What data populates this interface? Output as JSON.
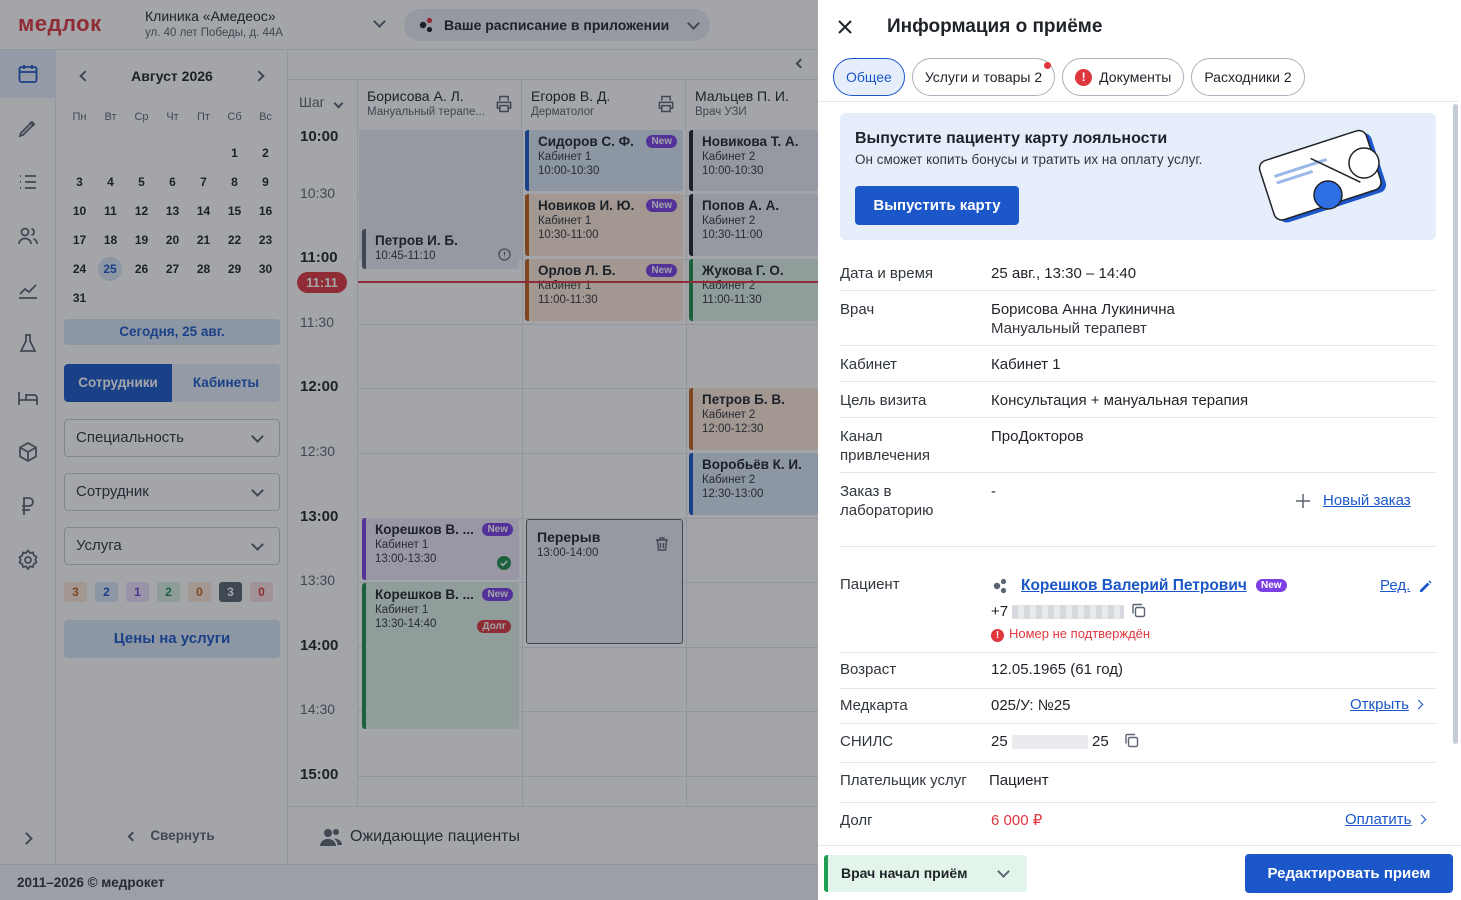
{
  "header": {
    "logo": "медлок",
    "clinic_name": "Клиника «Амедеос»",
    "clinic_address": "ул. 40 лет Победы, д. 44А",
    "app_promo": "Ваше расписание в приложении"
  },
  "calendar": {
    "month": "Август 2026",
    "weekdays": [
      "Пн",
      "Вт",
      "Ср",
      "Чт",
      "Пт",
      "Сб",
      "Вс"
    ],
    "weeks": [
      [
        "",
        "",
        "",
        "",
        "",
        "1",
        "2"
      ],
      [
        "3",
        "4",
        "5",
        "6",
        "7",
        "8",
        "9"
      ],
      [
        "10",
        "11",
        "12",
        "13",
        "14",
        "15",
        "16"
      ],
      [
        "17",
        "18",
        "19",
        "20",
        "21",
        "22",
        "23"
      ],
      [
        "24",
        "25",
        "26",
        "27",
        "28",
        "29",
        "30"
      ],
      [
        "31",
        "",
        "",
        "",
        "",
        "",
        ""
      ]
    ],
    "today_day": "25",
    "today_button": "Сегодня, 25 авг."
  },
  "filters": {
    "tab_staff": "Сотрудники",
    "tab_rooms": "Кабинеты",
    "specialty": "Специальность",
    "employee": "Сотрудник",
    "service": "Услуга",
    "counters": [
      {
        "value": "3",
        "bg": "#fde8d7",
        "fg": "#c0621c"
      },
      {
        "value": "2",
        "bg": "#dbe6f6",
        "fg": "#1b57c9"
      },
      {
        "value": "1",
        "bg": "#ede2fb",
        "fg": "#7b3fe4"
      },
      {
        "value": "2",
        "bg": "#dcf1e3",
        "fg": "#1e8e4a"
      },
      {
        "value": "0",
        "bg": "#fde8d7",
        "fg": "#c0621c"
      },
      {
        "value": "3",
        "bg": "#5b6470",
        "fg": "#ffffff"
      },
      {
        "value": "0",
        "bg": "#fde2e2",
        "fg": "#e0363e"
      }
    ],
    "prices_button": "Цены на услуги",
    "collapse": "Свернуть"
  },
  "schedule": {
    "step_label": "Шаг",
    "doctors": [
      {
        "name": "Борисова А. Л.",
        "role": "Мануальный терапе..."
      },
      {
        "name": "Егоров В. Д.",
        "role": "Дерматолог"
      },
      {
        "name": "Мальцев П. И.",
        "role": "Врач УЗИ"
      }
    ],
    "times": [
      "10:00",
      "10:30",
      "11:00",
      "11:30",
      "12:00",
      "12:30",
      "13:00",
      "13:30",
      "14:00",
      "14:30",
      "15:00"
    ],
    "now": "11:11",
    "new_label": "New",
    "debt_label": "Долг",
    "appointments": {
      "a1": {
        "patient": "Петров И. Б.",
        "time": "10:45-11:10"
      },
      "a2": {
        "patient": "Корешков В. ...",
        "room": "Кабинет 1",
        "time": "13:00-13:30"
      },
      "a3": {
        "patient": "Корешков В. ...",
        "room": "Кабинет 1",
        "time": "13:30-14:40"
      },
      "b1": {
        "patient": "Сидоров С. Ф.",
        "room": "Кабинет 1",
        "time": "10:00-10:30"
      },
      "b2": {
        "patient": "Новиков И. Ю.",
        "room": "Кабинет 1",
        "time": "10:30-11:00"
      },
      "b3": {
        "patient": "Орлов Л. Б.",
        "room": "Кабинет 1",
        "time": "11:00-11:30"
      },
      "b4": {
        "patient": "Перерыв",
        "time": "13:00-14:00"
      },
      "c1": {
        "patient": "Новикова Т. А.",
        "room": "Кабинет 2",
        "time": "10:00-10:30"
      },
      "c2": {
        "patient": "Попов А. А.",
        "room": "Кабинет 2",
        "time": "10:30-11:00"
      },
      "c3": {
        "patient": "Жукова Г. О.",
        "room": "Кабинет 2",
        "time": "11:00-11:30"
      },
      "c4": {
        "patient": "Петров Б. В.",
        "room": "Кабинет 2",
        "time": "12:00-12:30"
      },
      "c5": {
        "patient": "Воробьёв К. И.",
        "room": "Кабинет 2",
        "time": "12:30-13:00"
      }
    },
    "waiting": "Ожидающие пациенты"
  },
  "footer": {
    "copyright": "2011–2026 © медрокет"
  },
  "drawer": {
    "title": "Информация о приёме",
    "tabs": {
      "general": "Общее",
      "services": "Услуги и товары 2",
      "documents": "Документы",
      "consumables": "Расходники 2"
    },
    "promo": {
      "title": "Выпустите пациенту карту лояльности",
      "desc": "Он сможет копить бонусы и тратить их на оплату услуг.",
      "button": "Выпустить карту"
    },
    "fields": {
      "datetime_label": "Дата и время",
      "datetime": "25 авг., 13:30 – 14:40",
      "doctor_label": "Врач",
      "doctor_name": "Борисова Анна Лукинична",
      "doctor_role": "Мануальный терапевт",
      "room_label": "Кабинет",
      "room": "Кабинет 1",
      "purpose_label": "Цель визита",
      "purpose": "Консультация + мануальная терапия",
      "channel_label_1": "Канал",
      "channel_label_2": "привлечения",
      "channel": "ПроДокторов",
      "lab_label_1": "Заказ в",
      "lab_label_2": "лабораторию",
      "lab": "-",
      "new_order": "Новый заказ",
      "patient_label": "Пациент",
      "patient": "Корешков Валерий Петрович",
      "edit": "Ред.",
      "phone_prefix": "+7",
      "phone_warning": "Номер не подтверждён",
      "age_label": "Возраст",
      "age": "12.05.1965 (61 год)",
      "medcard_label": "Медкарта",
      "medcard": "025/У: №25",
      "open": "Открыть",
      "snils_label": "СНИЛС",
      "snils_start": "25",
      "snils_end": "25",
      "payer_label": "Плательщик услуг",
      "payer": "Пациент",
      "debt_label": "Долг",
      "debt": "6 000 ₽",
      "pay": "Оплатить"
    },
    "status": "Врач начал приём",
    "edit_button": "Редактировать прием"
  }
}
